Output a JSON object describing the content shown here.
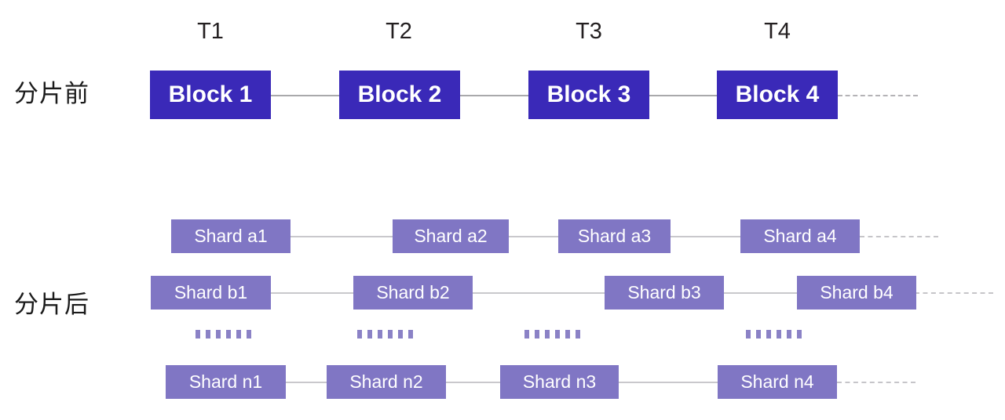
{
  "diagram": {
    "title_row_before": "分片前",
    "title_row_after": "分片后",
    "colors": {
      "block_fill": "#3a29b8",
      "shard_fill": "#8076c4",
      "link": "#a9a9ab",
      "shard_link": "#c9c8cc",
      "dashed_link": "#b4b3b6",
      "ellipsis_dot": "#8b82c6",
      "label_text": "#1b1b1b",
      "tick_text": "#231f20",
      "node_text": "#ffffff",
      "background": "#ffffff"
    },
    "ticks": [
      {
        "label": "T1"
      },
      {
        "label": "T2"
      },
      {
        "label": "T3"
      },
      {
        "label": "T4"
      }
    ],
    "rows": [
      {
        "id": "before",
        "kind": "block",
        "label": "分片前",
        "nodes": [
          {
            "label": "Block 1"
          },
          {
            "label": "Block 2"
          },
          {
            "label": "Block 3"
          },
          {
            "label": "Block 4"
          }
        ],
        "trailing": "dashed"
      },
      {
        "id": "shard-a",
        "kind": "shard",
        "nodes": [
          {
            "label": "Shard a1"
          },
          {
            "label": "Shard a2"
          },
          {
            "label": "Shard a3"
          },
          {
            "label": "Shard a4"
          }
        ],
        "trailing": "dashed"
      },
      {
        "id": "shard-b",
        "kind": "shard",
        "label": "分片后",
        "nodes": [
          {
            "label": "Shard b1"
          },
          {
            "label": "Shard b2"
          },
          {
            "label": "Shard b3"
          },
          {
            "label": "Shard b4"
          }
        ],
        "trailing": "dashed"
      },
      {
        "id": "ellipsis",
        "kind": "ellipsis",
        "groups": [
          6,
          6,
          6,
          6
        ]
      },
      {
        "id": "shard-n",
        "kind": "shard",
        "nodes": [
          {
            "label": "Shard n1"
          },
          {
            "label": "Shard n2"
          },
          {
            "label": "Shard n3"
          },
          {
            "label": "Shard n4"
          }
        ],
        "trailing": "dashed"
      }
    ]
  }
}
